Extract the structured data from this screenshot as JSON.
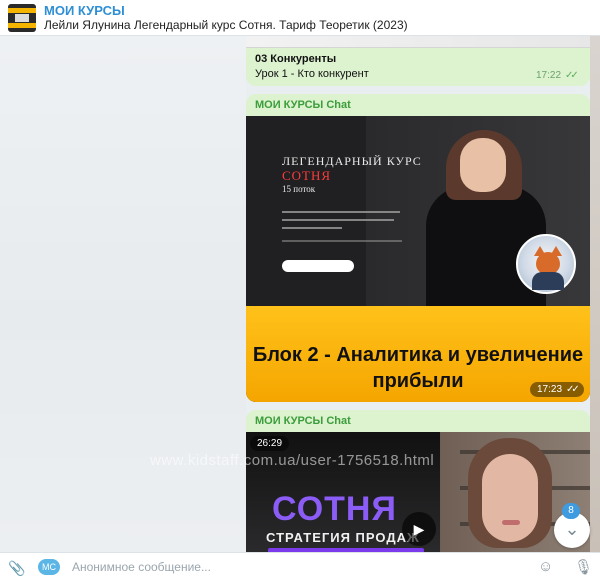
{
  "header": {
    "channel_name": "МОИ КУРСЫ",
    "subtitle": "Лейли Ялунина Легендарный курс Сотня. Тариф Теоретик (2023)"
  },
  "messages": [
    {
      "title": "03 Конкуренты",
      "text": "Урок 1 - Кто конкурент",
      "time": "17:22",
      "status": "read"
    },
    {
      "sender": "МОИ КУРСЫ Chat",
      "image_caption": "Блок 2 - Аналитика и увеличение прибыли",
      "promo_line1": "ЛЕГЕНДАРНЫЙ КУРС",
      "promo_line2": "СОТНЯ",
      "promo_line3": "15 поток",
      "time": "17:23",
      "status": "read"
    },
    {
      "sender": "МОИ КУРСЫ Chat",
      "duration": "26:29",
      "video_title": "СОТНЯ",
      "video_subtitle": "СТРАТЕГИЯ ПРОДАЖ"
    }
  ],
  "scroll": {
    "unread_count": "8"
  },
  "watermark": "www.kidstaff.com.ua/user-1756518.html",
  "input": {
    "avatar_initials": "MC",
    "placeholder": "Анонимное сообщение..."
  },
  "icons": {
    "attach": "paperclip-icon",
    "emoji": "smile-icon",
    "mic": "microphone-icon",
    "play": "play-icon",
    "scroll_down": "chevron-down-icon",
    "read_status": "double-check-icon"
  },
  "colors": {
    "accent": "#2f8fd4",
    "bubble": "#ddf2cf",
    "sender": "#3b9d3b",
    "promo_yellow": "#ffc21a",
    "sotnya_purple": "#8b5cf6"
  }
}
